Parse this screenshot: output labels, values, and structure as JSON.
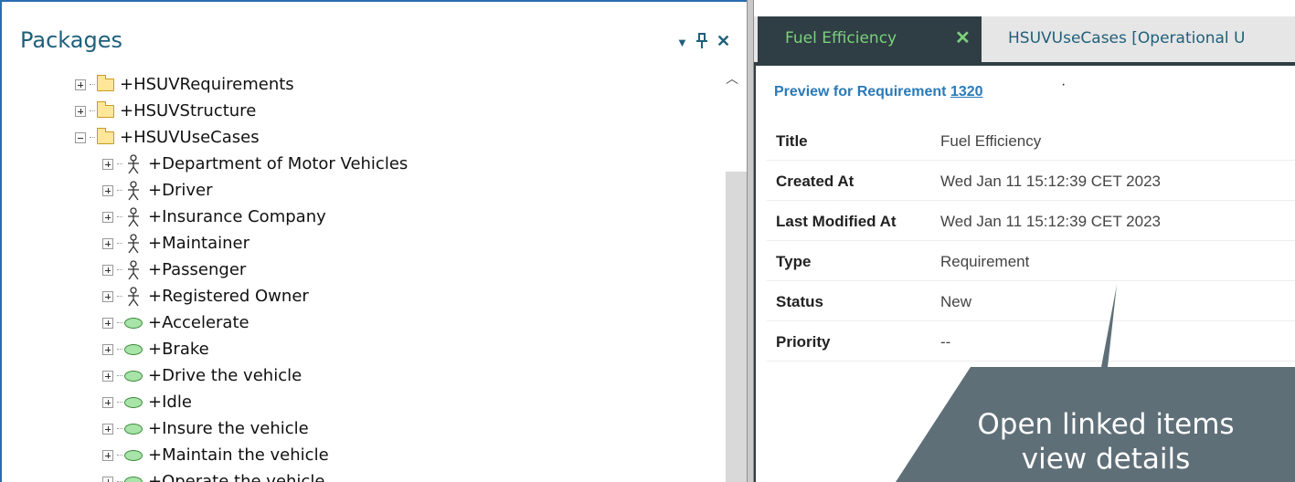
{
  "packages": {
    "title": "Packages",
    "header_buttons": [
      "dropdown-icon",
      "pin-icon",
      "close-icon"
    ],
    "tree": [
      {
        "label": "+HSUVRequirements",
        "icon": "folder-icon",
        "expander": "plus",
        "indent": 0
      },
      {
        "label": "+HSUVStructure",
        "icon": "folder-icon",
        "expander": "plus",
        "indent": 0
      },
      {
        "label": "+HSUVUseCases",
        "icon": "folder-icon",
        "expander": "minus",
        "indent": 0
      },
      {
        "label": "+Department of Motor Vehicles",
        "icon": "actor-icon",
        "expander": "plus",
        "indent": 1
      },
      {
        "label": "+Driver",
        "icon": "actor-icon",
        "expander": "plus",
        "indent": 1
      },
      {
        "label": "+Insurance Company",
        "icon": "actor-icon",
        "expander": "plus",
        "indent": 1
      },
      {
        "label": "+Maintainer",
        "icon": "actor-icon",
        "expander": "plus",
        "indent": 1
      },
      {
        "label": "+Passenger",
        "icon": "actor-icon",
        "expander": "plus",
        "indent": 1
      },
      {
        "label": "+Registered Owner",
        "icon": "actor-icon",
        "expander": "plus",
        "indent": 1
      },
      {
        "label": "+Accelerate",
        "icon": "usecase-icon",
        "expander": "plus",
        "indent": 1
      },
      {
        "label": "+Brake",
        "icon": "usecase-icon",
        "expander": "plus",
        "indent": 1
      },
      {
        "label": "+Drive the vehicle",
        "icon": "usecase-icon",
        "expander": "plus",
        "indent": 1
      },
      {
        "label": "+Idle",
        "icon": "usecase-icon",
        "expander": "plus",
        "indent": 1
      },
      {
        "label": "+Insure the vehicle",
        "icon": "usecase-icon",
        "expander": "plus",
        "indent": 1
      },
      {
        "label": "+Maintain the vehicle",
        "icon": "usecase-icon",
        "expander": "plus",
        "indent": 1
      },
      {
        "label": "+Operate the vehicle",
        "icon": "usecase-icon",
        "expander": "plus",
        "indent": 1
      }
    ]
  },
  "tabs": {
    "active": {
      "label": "Fuel Efficiency",
      "close_glyph": "✕"
    },
    "inactive": {
      "label": "HSUVUseCases [Operational U"
    }
  },
  "preview": {
    "heading_prefix": "Preview for Requirement",
    "requirement_id": "1320",
    "dot": "·",
    "properties": [
      {
        "key": "Title",
        "value": "Fuel Efficiency"
      },
      {
        "key": "Created At",
        "value": "Wed Jan 11 15:12:39 CET 2023"
      },
      {
        "key": "Last Modified At",
        "value": "Wed Jan 11 15:12:39 CET 2023"
      },
      {
        "key": "Type",
        "value": "Requirement"
      },
      {
        "key": "Status",
        "value": "New"
      },
      {
        "key": "Priority",
        "value": "--"
      }
    ]
  },
  "callout": {
    "line1": "Open linked items",
    "line2": "view details"
  },
  "colors": {
    "accent_blue": "#2b6cb0",
    "tab_dark": "#2f3e44",
    "tab_green": "#7cd07c",
    "callout_gray": "#5f6f78",
    "marker_red": "#e02020"
  }
}
